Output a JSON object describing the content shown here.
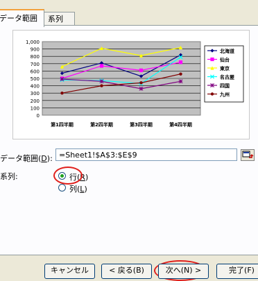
{
  "tabs": [
    {
      "label": "データ範囲"
    },
    {
      "label": "系列"
    }
  ],
  "data_range": {
    "label": "データ範囲(",
    "accel": "D",
    "label_end": "):",
    "value": "=Sheet1!$A$3:$E$9"
  },
  "series": {
    "label": "系列:",
    "options": [
      {
        "label": "行(",
        "accel": "R",
        "label_end": ")",
        "selected": true
      },
      {
        "label": "列(",
        "accel": "L",
        "label_end": ")",
        "selected": false
      }
    ]
  },
  "buttons": {
    "cancel": "キャンセル",
    "back": "< 戻る(B)",
    "next": "次へ(N) >",
    "finish": "完了(F)"
  },
  "chart_data": {
    "type": "line",
    "categories": [
      "第1四半期",
      "第2四半期",
      "第3四半期",
      "第4四半期"
    ],
    "ylim": [
      0,
      1000
    ],
    "yticks": [
      "0",
      "100",
      "200",
      "300",
      "400",
      "500",
      "600",
      "700",
      "800",
      "900",
      "1,000"
    ],
    "grid": true,
    "legend": "right",
    "series": [
      {
        "name": "北海道",
        "color": "#000080",
        "marker": "diamond",
        "values": [
          570,
          710,
          530,
          820
        ]
      },
      {
        "name": "仙台",
        "color": "#ff00ff",
        "marker": "square",
        "values": [
          500,
          670,
          610,
          720
        ]
      },
      {
        "name": "東京",
        "color": "#ffff00",
        "marker": "triangle",
        "values": [
          660,
          910,
          810,
          920
        ]
      },
      {
        "name": "名古屋",
        "color": "#00ffff",
        "marker": "x",
        "values": [
          480,
          470,
          430,
          790
        ]
      },
      {
        "name": "四国",
        "color": "#800080",
        "marker": "star",
        "values": [
          490,
          460,
          360,
          460
        ]
      },
      {
        "name": "九州",
        "color": "#800000",
        "marker": "circle",
        "values": [
          300,
          400,
          440,
          560
        ]
      }
    ]
  }
}
